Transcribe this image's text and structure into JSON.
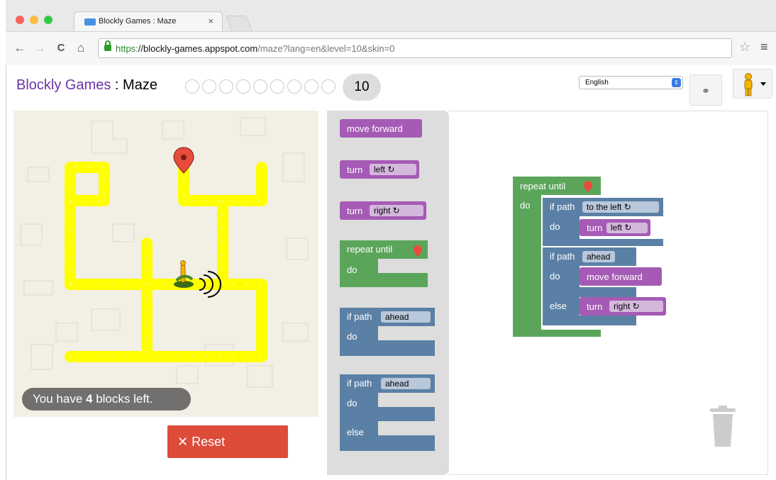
{
  "browser": {
    "tab_title": "Blockly Games : Maze",
    "tab_close": "×",
    "url_scheme": "https:",
    "url_host": "//blockly-games.appspot.com",
    "url_path": "/maze?lang=en&level=10&skin=0",
    "back": "←",
    "forward": "→",
    "reload": "C",
    "home": "⌂",
    "bookmark": "☆",
    "menu": "≡"
  },
  "header": {
    "title_link": "Blockly Games",
    "title_sep": " : ",
    "title_page": "Maze",
    "current_level": "10",
    "language": "English",
    "link_icon": "⚭"
  },
  "maze": {
    "blocks_left_prefix": "You have ",
    "blocks_left_count": "4",
    "blocks_left_suffix": " blocks left.",
    "reset_icon": "✕",
    "reset_label": "Reset"
  },
  "toolbox": {
    "move_forward": "move forward",
    "turn": "turn",
    "left": "left ↻",
    "right": "right ↻",
    "repeat_until": "repeat until",
    "do": "do",
    "if_path": "if path",
    "ahead": "ahead",
    "else": "else"
  },
  "workspace": {
    "repeat_until": "repeat until",
    "do": "do",
    "if_path": "if path",
    "to_the_left": "to the left ↻",
    "turn": "turn",
    "left": "left ↻",
    "ahead": "ahead",
    "move_forward": "move forward",
    "else": "else",
    "right": "right ↻"
  },
  "colors": {
    "motion": "#a55bb5",
    "loop": "#5ba55b",
    "logic": "#5b80a5",
    "path": "#ffff00",
    "reset": "#dd4b39",
    "title_link": "#6b33a8"
  }
}
